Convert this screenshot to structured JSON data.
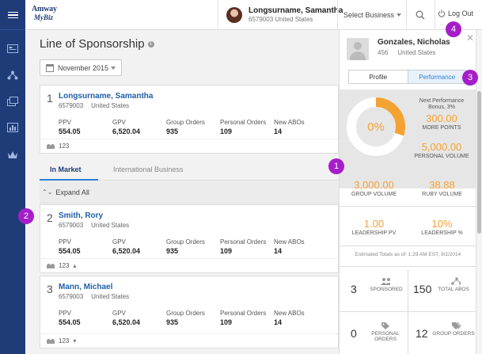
{
  "header": {
    "logo_line1": "Amway",
    "logo_line2": "MyBiz",
    "user_name": "Longsurname, Samantha",
    "user_id": "6579003 United States",
    "select_business": "Select Business",
    "logout": "Log Out"
  },
  "main": {
    "title": "Line of Sponsorship",
    "month": "November 2015",
    "metric_labels": [
      "PPV",
      "GPV",
      "Group Orders",
      "Personal Orders",
      "New ABOs"
    ],
    "sponsor_card": {
      "index": "1",
      "name": "Longsurname, Samantha",
      "id": "6579003",
      "country": "United States",
      "values": [
        "554.05",
        "6,520.04",
        "935",
        "109",
        "14"
      ],
      "count": "123"
    },
    "tabs": [
      "In Market",
      "International Business"
    ],
    "expand_all": "Expand All",
    "downlines": [
      {
        "index": "2",
        "name": "Smith, Rory",
        "id": "6579003",
        "country": "United States",
        "values": [
          "554.05",
          "6,520.04",
          "935",
          "109",
          "14"
        ],
        "count": "123"
      },
      {
        "index": "3",
        "name": "Mann, Michael",
        "id": "6579003",
        "country": "United States",
        "values": [
          "554.05",
          "6,520.04",
          "935",
          "109",
          "14"
        ],
        "count": "123"
      }
    ]
  },
  "panel": {
    "name": "Gonzales, Nicholas",
    "id": "456",
    "country": "United States",
    "tab_profile": "Profile",
    "tab_performance": "Performance",
    "ring_percent": "0%",
    "ring_progress_fraction": 0.3,
    "next_perf": "Next Performance Bonus, 3%",
    "more_points_value": "300.00",
    "more_points_label": "MORE POINTS",
    "personal_volume_value": "5,000.00",
    "personal_volume_label": "PERSONAL VOLUME",
    "group_volume_value": "3,000.00",
    "group_volume_label": "GROUP VOLUME",
    "ruby_volume_value": "38.88",
    "ruby_volume_label": "RUBY VOLUME",
    "leadership_pv_value": "1.00",
    "leadership_pv_label": "LEADERSHIP PV",
    "leadership_pct_value": "10%",
    "leadership_pct_label": "LEADERSHIP %",
    "estimated": "Estimated Totals as of: 1:29 AM EST, 9/2/2014",
    "sponsored_value": "3",
    "sponsored_label": "SPONSORED",
    "total_abos_value": "150",
    "total_abos_label": "TOTAL ABOS",
    "personal_orders_value": "0",
    "personal_orders_label": "PERSONAL ORDERS",
    "group_orders_value": "12",
    "group_orders_label": "GROUP ORDERS"
  },
  "callouts": [
    "1",
    "2",
    "3",
    "4"
  ],
  "colors": {
    "rail": "#1f3c78",
    "accent_orange": "#f4a233",
    "link_blue": "#1f5fa8",
    "callout": "#a51ec9"
  }
}
